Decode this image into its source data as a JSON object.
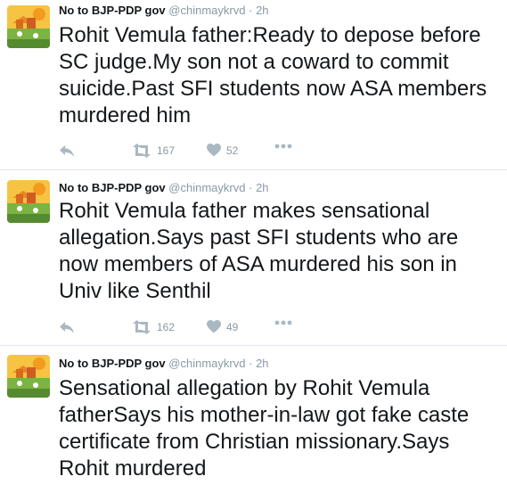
{
  "tweets": [
    {
      "display_name": "No to BJP-PDP gov",
      "handle": "@chinmaykrvd",
      "time": "2h",
      "text": "Rohit Vemula father:Ready to depose before SC judge.My son not a coward to commit suicide.Past SFI students now ASA members murdered him",
      "retweets": "167",
      "likes": "52"
    },
    {
      "display_name": "No to BJP-PDP gov",
      "handle": "@chinmaykrvd",
      "time": "2h",
      "text": "Rohit Vemula father makes sensational allegation.Says past SFI students who are now members of ASA murdered his son in Univ like Senthil",
      "retweets": "162",
      "likes": "49"
    },
    {
      "display_name": "No to BJP-PDP gov",
      "handle": "@chinmaykrvd",
      "time": "2h",
      "text": "Sensational allegation by Rohit Vemula fatherSays his mother-in-law got fake caste certificate from Christian missionary.Says Rohit murdered"
    }
  ],
  "separator": "·",
  "icons": {
    "reply": "reply-icon",
    "retweet": "retweet-icon",
    "like": "heart-icon",
    "more": "more-icon",
    "avatar": "avatar"
  },
  "colors": {
    "text": "#14171a",
    "muted": "#8899a6",
    "icon": "#aab8c2",
    "divider": "#e1e8ed"
  }
}
